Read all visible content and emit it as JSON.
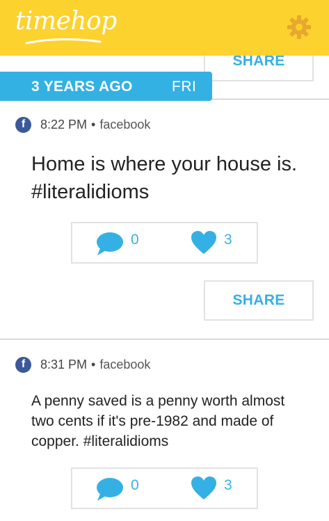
{
  "header": {
    "logo_text": "timehop",
    "settings_icon": "gear-icon",
    "brand_color": "#fcd22f"
  },
  "banner": {
    "years_ago": "3 YEARS AGO",
    "day": "FRI",
    "color": "#33b1e3"
  },
  "share_label": "SHARE",
  "posts": [
    {
      "time": "8:22 PM",
      "separator": "•",
      "source": "facebook",
      "source_icon": "facebook-icon",
      "text": "Home is where your house is. #literalidioms",
      "comments": "0",
      "likes": "3"
    },
    {
      "time": "8:31 PM",
      "separator": "•",
      "source": "facebook",
      "source_icon": "facebook-icon",
      "text": "A penny saved is a penny worth almost two cents if it's pre-1982 and made of copper. #literalidioms",
      "comments": "0",
      "likes": "3"
    }
  ]
}
